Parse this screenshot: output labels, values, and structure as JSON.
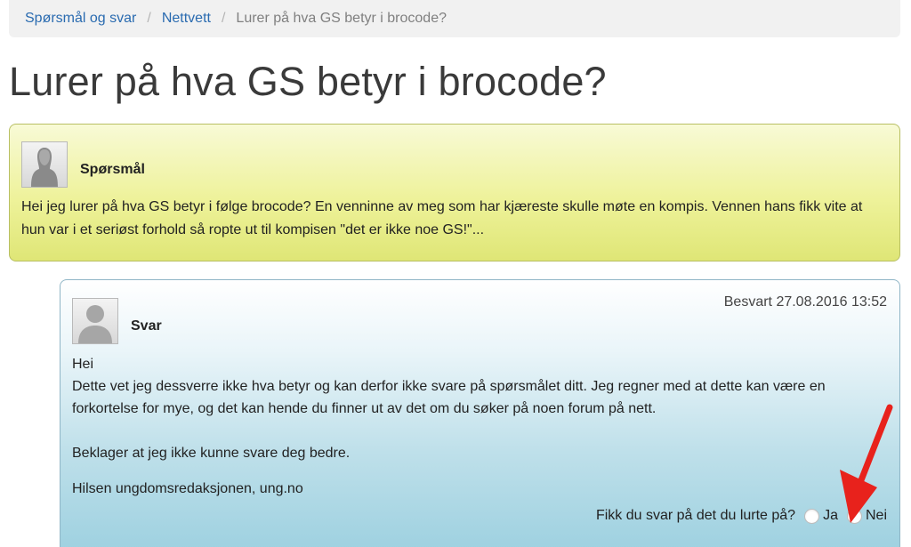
{
  "breadcrumb": {
    "items": [
      {
        "label": "Spørsmål og svar"
      },
      {
        "label": "Nettvett"
      }
    ],
    "current": "Lurer på hva GS betyr i brocode?"
  },
  "page_title": "Lurer på hva GS betyr i brocode?",
  "question": {
    "role_label": "Spørsmål",
    "text": "Hei jeg lurer på hva GS betyr i følge brocode? En venninne av meg som har kjæreste skulle møte en kompis. Vennen hans fikk vite at hun var i et seriøst forhold så ropte ut til kompisen \"det er ikke noe GS!\"..."
  },
  "answer": {
    "answered_at": "Besvart 27.08.2016 13:52",
    "role_label": "Svar",
    "greeting": "Hei",
    "body": "Dette vet jeg dessverre ikke hva betyr og kan derfor ikke svare på spørsmålet ditt. Jeg regner med at dette kan være en forkortelse for mye, og det kan hende du finner ut av det om du søker på noen forum på nett.",
    "apology": "Beklager at jeg ikke kunne svare deg bedre.",
    "signature": "Hilsen ungdomsredaksjonen, ung.no"
  },
  "feedback": {
    "question": "Fikk du svar på det du lurte på?",
    "yes_label": "Ja",
    "no_label": "Nei"
  },
  "colors": {
    "link": "#2a6bb0",
    "question_bg": "#eef29a",
    "answer_bg": "#bfe0ea",
    "arrow": "#e8221c"
  },
  "icons": {
    "question_avatar": "person-silhouette-icon",
    "answer_avatar": "person-silhouette-icon",
    "annotation": "red-arrow-icon"
  }
}
